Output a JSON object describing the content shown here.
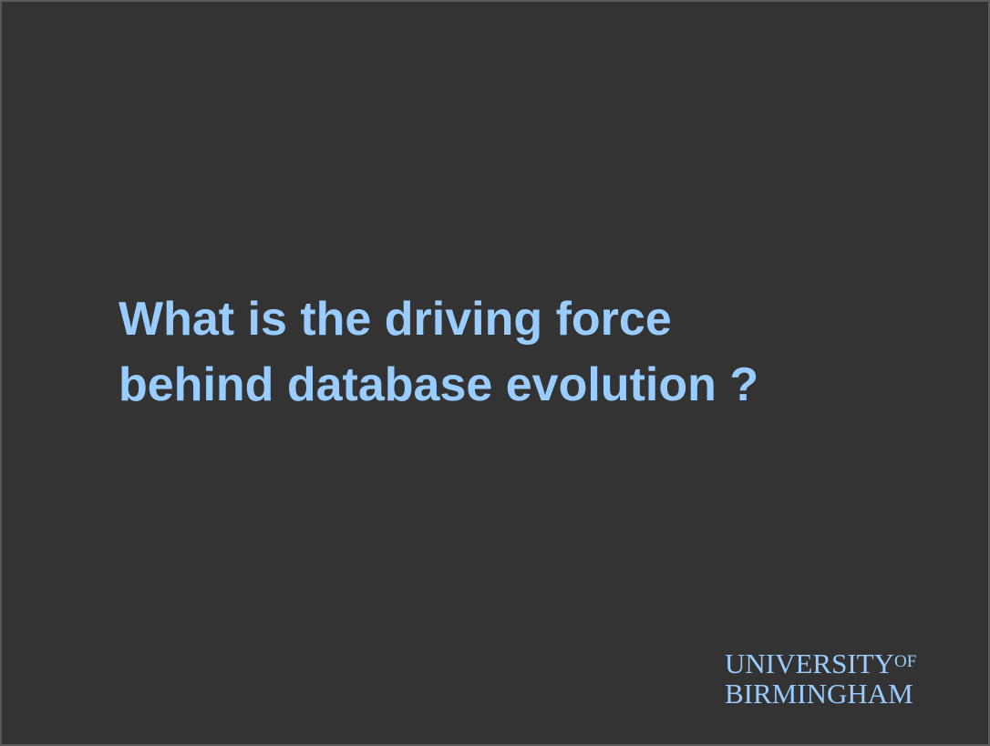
{
  "slide": {
    "title_lines": [
      "What is the driving force",
      "behind database evolution ?"
    ]
  },
  "logo": {
    "line1": "UNIVERSITY",
    "of": "OF",
    "line2": "BIRMINGHAM"
  },
  "colors": {
    "background": "#333333",
    "text": "#99ccff"
  }
}
